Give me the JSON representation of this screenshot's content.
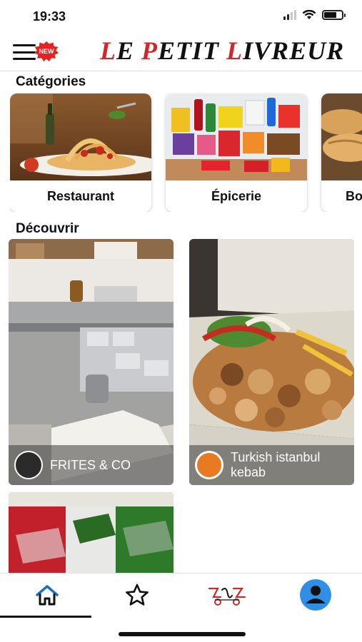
{
  "status": {
    "time": "19:33",
    "battery_level": 0.7
  },
  "header": {
    "badge": "NEW",
    "logo": {
      "part1": "L",
      "part2": "E ",
      "part3": "P",
      "part4": "ETIT ",
      "part5": "L",
      "part6": "IVREUR"
    },
    "brand_color": "#d3262a"
  },
  "categories": {
    "title": "Catégories",
    "items": [
      {
        "label": "Restaurant"
      },
      {
        "label": "Épicerie"
      },
      {
        "label": "Bo"
      }
    ]
  },
  "discover": {
    "title": "Découvrir",
    "items": [
      {
        "name": "FRITES & CO"
      },
      {
        "name": "Turkish istanbul kebab"
      },
      {
        "name": ""
      }
    ]
  },
  "tabbar": {
    "items": [
      {
        "icon": "home-icon",
        "active": true
      },
      {
        "icon": "star-icon",
        "active": false
      },
      {
        "icon": "scooter-logo-icon",
        "active": false
      },
      {
        "icon": "profile-icon",
        "active": false
      }
    ],
    "accent": "#2f8fe6"
  }
}
